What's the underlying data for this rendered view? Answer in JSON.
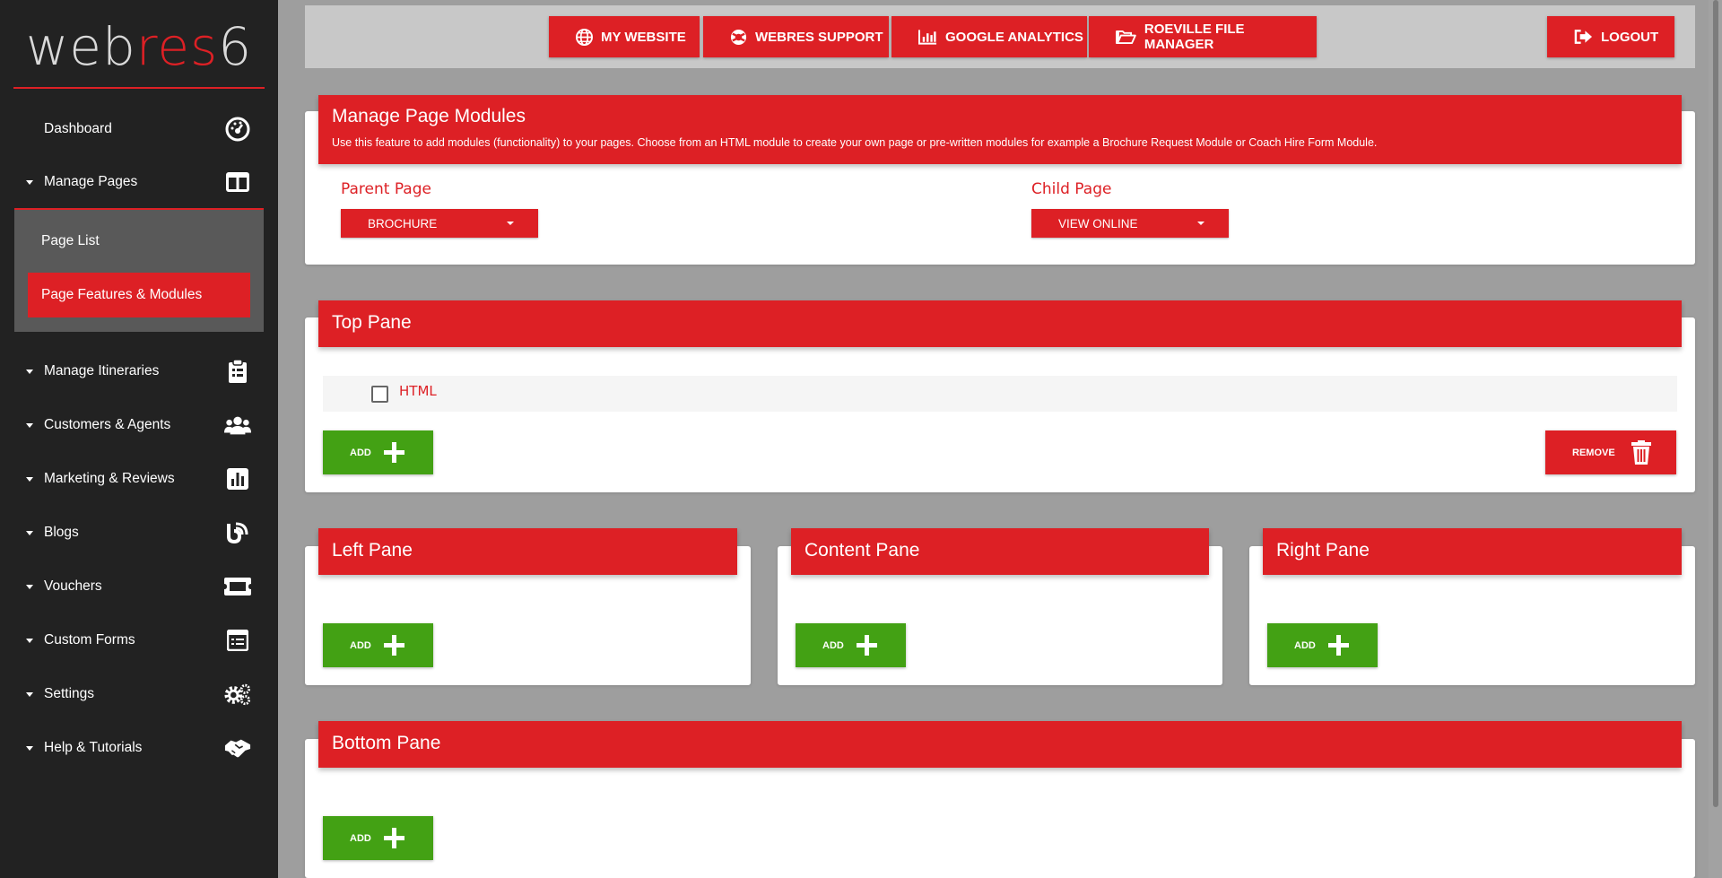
{
  "brand": {
    "logo_part1": "web",
    "logo_part2": "res",
    "logo_part3": "6",
    "accent_color": "#dd2025",
    "sidebar_bg": "#222222"
  },
  "sidebar": {
    "items": [
      {
        "label": "Dashboard",
        "icon": "dashboard-icon"
      },
      {
        "label": "Manage Pages",
        "icon": "columns-icon"
      },
      {
        "label": "Manage Itineraries",
        "icon": "clipboard-icon"
      },
      {
        "label": "Customers & Agents",
        "icon": "users-icon"
      },
      {
        "label": "Marketing & Reviews",
        "icon": "bar-chart-icon"
      },
      {
        "label": "Blogs",
        "icon": "blog-icon"
      },
      {
        "label": "Vouchers",
        "icon": "ticket-icon"
      },
      {
        "label": "Custom Forms",
        "icon": "form-icon"
      },
      {
        "label": "Settings",
        "icon": "gears-icon"
      },
      {
        "label": "Help & Tutorials",
        "icon": "handshake-icon"
      }
    ],
    "submenu": [
      {
        "label": "Page List"
      },
      {
        "label": "Page Features & Modules"
      }
    ]
  },
  "topbar": {
    "my_website": "MY WEBSITE",
    "support": "WEBRES SUPPORT",
    "analytics": "GOOGLE ANALYTICS",
    "file_manager": "ROEVILLE FILE MANAGER",
    "logout": "LOGOUT"
  },
  "modules": {
    "title": "Manage Page Modules",
    "description": "Use this feature to add modules (functionality) to your pages. Choose from an HTML module to create your own page or pre-written modules for example a Brochure Request Module or Coach Hire Form Module.",
    "parent_label": "Parent Page",
    "parent_value": "BROCHURE",
    "child_label": "Child Page",
    "child_value": "VIEW ONLINE"
  },
  "panes": {
    "top": {
      "title": "Top Pane",
      "module": "HTML",
      "add": "ADD",
      "remove": "REMOVE"
    },
    "left": {
      "title": "Left Pane",
      "add": "ADD"
    },
    "content": {
      "title": "Content Pane",
      "add": "ADD"
    },
    "right": {
      "title": "Right Pane",
      "add": "ADD"
    },
    "bottom": {
      "title": "Bottom Pane",
      "add": "ADD"
    }
  },
  "colors": {
    "add_green": "#43a114",
    "page_bg": "#9e9e9e"
  }
}
